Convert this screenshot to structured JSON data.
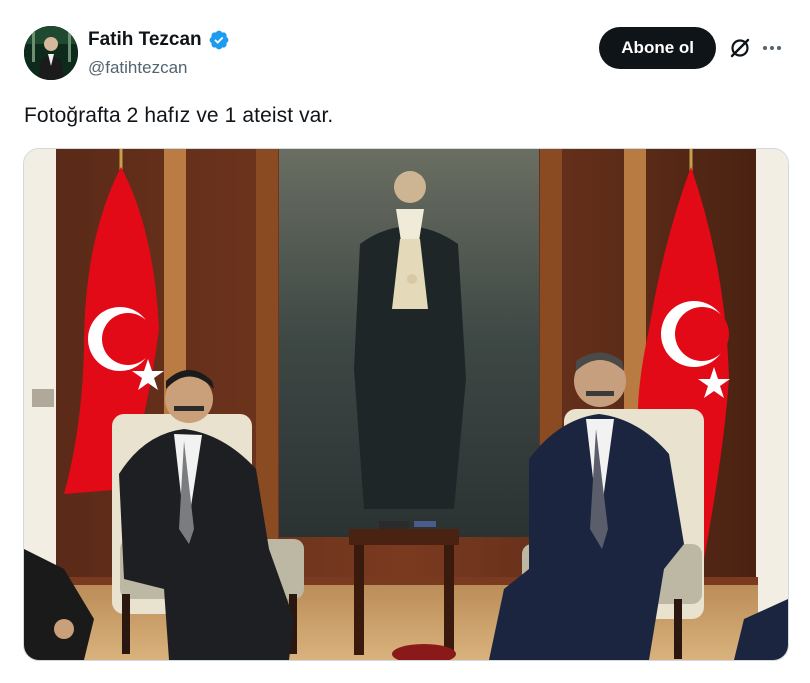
{
  "author": {
    "display_name": "Fatih Tezcan",
    "handle": "@fatihtezcan",
    "verified": true,
    "verified_color": "#1d9bf0"
  },
  "actions": {
    "follow_label": "Abone ol",
    "grok_icon": "grok-icon",
    "more_icon": "more-icon"
  },
  "tweet": {
    "text": "Fotoğrafta 2 hafız ve 1 ateist var."
  },
  "media": {
    "kind": "photo",
    "icon": "photo-icon"
  },
  "colors": {
    "text_primary": "#0f1419",
    "text_secondary": "#536471",
    "button_bg": "#0f1419",
    "border": "#cfd9de",
    "flag_red": "#e30a17"
  }
}
